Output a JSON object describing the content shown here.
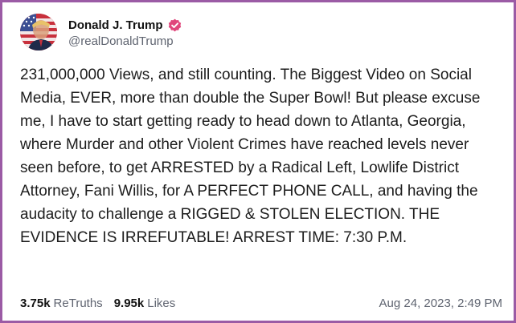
{
  "post": {
    "author": {
      "display_name": "Donald J. Trump",
      "handle": "@realDonaldTrump",
      "verified": true
    },
    "text": "231,000,000 Views, and still counting. The Biggest Video on Social Media, EVER, more than double the Super Bowl! But please excuse me, I have to start getting ready to head down to Atlanta, Georgia, where Murder and other Violent Crimes have reached levels never seen before, to get ARRESTED by a Radical Left, Lowlife District Attorney, Fani Willis, for A PERFECT PHONE CALL, and having the audacity to challenge a RIGGED & STOLEN ELECTION. THE EVIDENCE IS IRREFUTABLE! ARREST TIME: 7:30 P.M.",
    "stats": {
      "retruths_count": "3.75k",
      "retruths_label": "ReTruths",
      "likes_count": "9.95k",
      "likes_label": "Likes"
    },
    "timestamp": "Aug 24, 2023, 2:49 PM"
  },
  "theme": {
    "border_color": "#9b5ba5",
    "verified_badge_color": "#e0457b",
    "secondary_text_color": "#5f6470"
  },
  "icons": {
    "avatar": "avatar-flag-portrait",
    "verified": "verified-badge-icon"
  }
}
